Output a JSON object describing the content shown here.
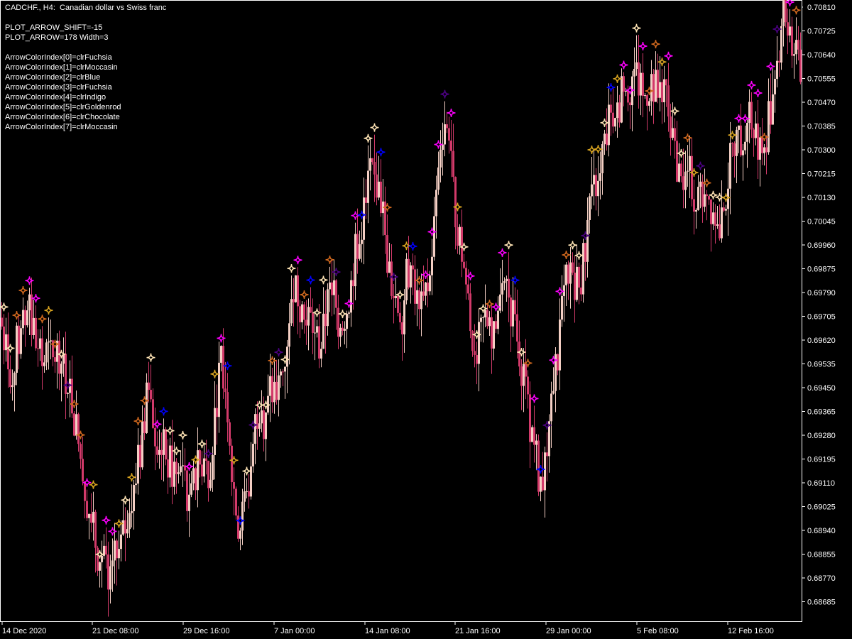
{
  "header": {
    "symbol_line": "CADCHF., H4:  Canadian dollar vs Swiss franc",
    "shift_line": "PLOT_ARROW_SHIFT=-15",
    "arrow_line": "PLOT_ARROW=178 Width=3",
    "color_index_lines": [
      "ArrowColorIndex[0]=clrFuchsia",
      "ArrowColorIndex[1]=clrMoccasin",
      "ArrowColorIndex[2]=clrBlue",
      "ArrowColorIndex[3]=clrFuchsia",
      "ArrowColorIndex[4]=clrIndigo",
      "ArrowColorIndex[5]=clrGoldenrod",
      "ArrowColorIndex[6]=clrChocolate",
      "ArrowColorIndex[7]=clrMoccasin"
    ]
  },
  "colors": {
    "background": "#000000",
    "frame": "#ffffff",
    "bear_candle": "#d23a6a",
    "bull_candle": "#f4cfc4",
    "arrow_palette": [
      "#ff00ff",
      "#ffe4b5",
      "#0000ff",
      "#ff00ff",
      "#4b0082",
      "#daa520",
      "#d2691e",
      "#ffe4b5"
    ]
  },
  "chart_data": {
    "type": "candlestick",
    "title": "CADCHF., H4:  Canadian dollar vs Swiss franc",
    "ylim": [
      0.6863,
      0.7085
    ],
    "y_ticks": [
      "0.70810",
      "0.70725",
      "0.70640",
      "0.70555",
      "0.70470",
      "0.70385",
      "0.70300",
      "0.70215",
      "0.70130",
      "0.70045",
      "0.69960",
      "0.69875",
      "0.69790",
      "0.69705",
      "0.69620",
      "0.69535",
      "0.69450",
      "0.69365",
      "0.69280",
      "0.69195",
      "0.69110",
      "0.69025",
      "0.68940",
      "0.68855",
      "0.68770",
      "0.68685"
    ],
    "x_ticks": [
      "14 Dec 2020",
      "21 Dec 08:00",
      "29 Dec 16:00",
      "7 Jan 00:00",
      "14 Jan 08:00",
      "21 Jan 16:00",
      "29 Jan 00:00",
      "5 Feb 08:00",
      "12 Feb 16:00"
    ],
    "current_price": "0.70810",
    "close_path": [
      [
        0,
        0.697
      ],
      [
        8,
        0.6958
      ],
      [
        16,
        0.695
      ],
      [
        24,
        0.6961
      ],
      [
        32,
        0.6965
      ],
      [
        38,
        0.6975
      ],
      [
        44,
        0.6968
      ],
      [
        52,
        0.6962
      ],
      [
        58,
        0.6952
      ],
      [
        66,
        0.6958
      ],
      [
        74,
        0.6955
      ],
      [
        82,
        0.6959
      ],
      [
        90,
        0.695
      ],
      [
        98,
        0.6945
      ],
      [
        106,
        0.6932
      ],
      [
        114,
        0.6918
      ],
      [
        122,
        0.6905
      ],
      [
        130,
        0.6895
      ],
      [
        138,
        0.6885
      ],
      [
        146,
        0.6888
      ],
      [
        152,
        0.687
      ],
      [
        158,
        0.688
      ],
      [
        164,
        0.6885
      ],
      [
        170,
        0.6888
      ],
      [
        176,
        0.6895
      ],
      [
        182,
        0.6905
      ],
      [
        188,
        0.6912
      ],
      [
        196,
        0.692
      ],
      [
        202,
        0.693
      ],
      [
        208,
        0.6955
      ],
      [
        212,
        0.694
      ],
      [
        218,
        0.693
      ],
      [
        226,
        0.6926
      ],
      [
        234,
        0.692
      ],
      [
        242,
        0.6915
      ],
      [
        250,
        0.6912
      ],
      [
        258,
        0.692
      ],
      [
        266,
        0.69
      ],
      [
        272,
        0.691
      ],
      [
        278,
        0.6915
      ],
      [
        286,
        0.692
      ],
      [
        294,
        0.6915
      ],
      [
        300,
        0.693
      ],
      [
        306,
        0.6945
      ],
      [
        312,
        0.6955
      ],
      [
        318,
        0.6945
      ],
      [
        324,
        0.6925
      ],
      [
        330,
        0.6905
      ],
      [
        336,
        0.6895
      ],
      [
        342,
        0.69
      ],
      [
        348,
        0.6905
      ],
      [
        354,
        0.692
      ],
      [
        360,
        0.6935
      ],
      [
        366,
        0.694
      ],
      [
        372,
        0.6933
      ],
      [
        378,
        0.694
      ],
      [
        384,
        0.6945
      ],
      [
        390,
        0.6942
      ],
      [
        396,
        0.695
      ],
      [
        402,
        0.6958
      ],
      [
        408,
        0.6975
      ],
      [
        414,
        0.6985
      ],
      [
        420,
        0.6978
      ],
      [
        426,
        0.6972
      ],
      [
        432,
        0.6965
      ],
      [
        438,
        0.697
      ],
      [
        444,
        0.6962
      ],
      [
        450,
        0.6958
      ],
      [
        456,
        0.6966
      ],
      [
        462,
        0.6978
      ],
      [
        468,
        0.6982
      ],
      [
        474,
        0.697
      ],
      [
        480,
        0.6968
      ],
      [
        486,
        0.6972
      ],
      [
        492,
        0.6978
      ],
      [
        498,
        0.699
      ],
      [
        504,
        0.6998
      ],
      [
        510,
        0.7005
      ],
      [
        516,
        0.7015
      ],
      [
        520,
        0.7022
      ],
      [
        524,
        0.7018
      ],
      [
        530,
        0.702
      ],
      [
        536,
        0.7012
      ],
      [
        542,
        0.7
      ],
      [
        548,
        0.6985
      ],
      [
        554,
        0.698
      ],
      [
        560,
        0.6975
      ],
      [
        566,
        0.6972
      ],
      [
        572,
        0.6985
      ],
      [
        578,
        0.699
      ],
      [
        584,
        0.698
      ],
      [
        590,
        0.697
      ],
      [
        596,
        0.6975
      ],
      [
        602,
        0.6982
      ],
      [
        608,
        0.6995
      ],
      [
        614,
        0.701
      ],
      [
        618,
        0.703
      ],
      [
        624,
        0.704
      ],
      [
        630,
        0.7042
      ],
      [
        634,
        0.7025
      ],
      [
        640,
        0.701
      ],
      [
        646,
        0.7
      ],
      [
        652,
        0.699
      ],
      [
        658,
        0.6978
      ],
      [
        664,
        0.6965
      ],
      [
        670,
        0.6958
      ],
      [
        676,
        0.6962
      ],
      [
        682,
        0.697
      ],
      [
        688,
        0.6965
      ],
      [
        694,
        0.696
      ],
      [
        700,
        0.6968
      ],
      [
        706,
        0.698
      ],
      [
        712,
        0.6982
      ],
      [
        718,
        0.6975
      ],
      [
        724,
        0.6968
      ],
      [
        730,
        0.696
      ],
      [
        736,
        0.695
      ],
      [
        742,
        0.694
      ],
      [
        748,
        0.693
      ],
      [
        754,
        0.692
      ],
      [
        760,
        0.6912
      ],
      [
        766,
        0.6918
      ],
      [
        772,
        0.6925
      ],
      [
        778,
        0.694
      ],
      [
        784,
        0.6955
      ],
      [
        790,
        0.697
      ],
      [
        796,
        0.698
      ],
      [
        802,
        0.699
      ],
      [
        808,
        0.6985
      ],
      [
        814,
        0.698
      ],
      [
        820,
        0.6988
      ],
      [
        826,
        0.6998
      ],
      [
        832,
        0.701
      ],
      [
        838,
        0.7018
      ],
      [
        844,
        0.7025
      ],
      [
        850,
        0.703
      ],
      [
        856,
        0.7038
      ],
      [
        862,
        0.7045
      ],
      [
        868,
        0.704
      ],
      [
        874,
        0.705
      ],
      [
        880,
        0.7055
      ],
      [
        886,
        0.7052
      ],
      [
        892,
        0.7058
      ],
      [
        898,
        0.7055
      ],
      [
        904,
        0.7048
      ],
      [
        910,
        0.705
      ],
      [
        916,
        0.7055
      ],
      [
        922,
        0.7052
      ],
      [
        928,
        0.705
      ],
      [
        934,
        0.7055
      ],
      [
        940,
        0.7045
      ],
      [
        946,
        0.7035
      ],
      [
        952,
        0.7025
      ],
      [
        958,
        0.7018
      ],
      [
        964,
        0.702
      ],
      [
        970,
        0.7022
      ],
      [
        976,
        0.7015
      ],
      [
        982,
        0.701
      ],
      [
        988,
        0.7015
      ],
      [
        994,
        0.7018
      ],
      [
        1000,
        0.7012
      ],
      [
        1006,
        0.7005
      ],
      [
        1012,
        0.7
      ],
      [
        1018,
        0.7005
      ],
      [
        1024,
        0.7018
      ],
      [
        1030,
        0.7028
      ],
      [
        1036,
        0.7035
      ],
      [
        1042,
        0.7032
      ],
      [
        1048,
        0.704
      ],
      [
        1054,
        0.7045
      ],
      [
        1060,
        0.7038
      ],
      [
        1066,
        0.7035
      ],
      [
        1072,
        0.703
      ],
      [
        1078,
        0.7035
      ],
      [
        1084,
        0.7045
      ],
      [
        1090,
        0.7055
      ],
      [
        1096,
        0.7065
      ],
      [
        1100,
        0.7078
      ],
      [
        1106,
        0.708
      ],
      [
        1112,
        0.7074
      ],
      [
        1118,
        0.7065
      ],
      [
        1124,
        0.7058
      ],
      [
        1128,
        0.7056
      ]
    ]
  }
}
